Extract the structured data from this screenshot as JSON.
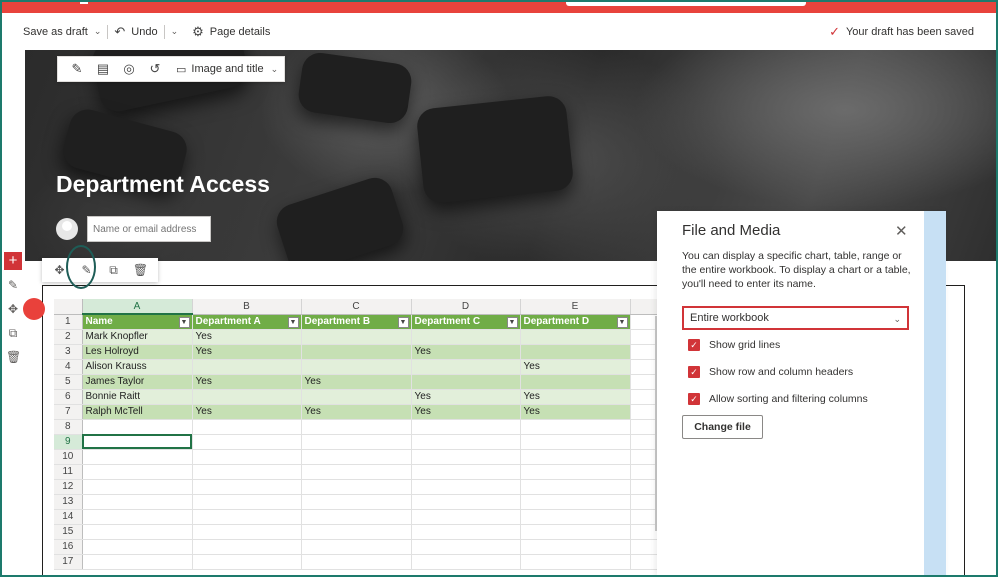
{
  "command_bar": {
    "save_draft": "Save as draft",
    "undo": "Undo",
    "page_details": "Page details",
    "saved_status": "Your draft has been saved"
  },
  "hero": {
    "toolbar_layout": "Image and title",
    "title": "Department Access",
    "name_placeholder": "Name or email address"
  },
  "sheet": {
    "columns": [
      "A",
      "B",
      "C",
      "D",
      "E"
    ],
    "selected_column": "A",
    "selected_row": 9,
    "headers": [
      "Name",
      "Department A",
      "Department B",
      "Department C",
      "Department D"
    ],
    "rows": [
      [
        "Mark Knopfler",
        "Yes",
        "",
        "",
        ""
      ],
      [
        "Les Holroyd",
        "Yes",
        "",
        "Yes",
        ""
      ],
      [
        "Alison Krauss",
        "",
        "",
        "",
        "Yes"
      ],
      [
        "James Taylor",
        "Yes",
        "Yes",
        "",
        ""
      ],
      [
        "Bonnie Raitt",
        "",
        "",
        "Yes",
        "Yes"
      ],
      [
        "Ralph McTell",
        "Yes",
        "Yes",
        "Yes",
        "Yes"
      ]
    ],
    "row_numbers": [
      "1",
      "2",
      "3",
      "4",
      "5",
      "6",
      "7",
      "8",
      "9",
      "10",
      "11",
      "12",
      "13",
      "14",
      "15",
      "16",
      "17"
    ]
  },
  "panel": {
    "title": "File and Media",
    "description": "You can display a specific chart, table, range or the entire workbook. To display a chart or a table, you'll need to enter its name.",
    "select_value": "Entire workbook",
    "options": [
      {
        "label": "Show grid lines",
        "checked": true
      },
      {
        "label": "Show row and column headers",
        "checked": true
      },
      {
        "label": "Allow sorting and filtering columns",
        "checked": true
      }
    ],
    "change_file": "Change file"
  },
  "colors": {
    "accent_red": "#d13438",
    "excel_green": "#217346",
    "table_header_green": "#70ad47"
  }
}
